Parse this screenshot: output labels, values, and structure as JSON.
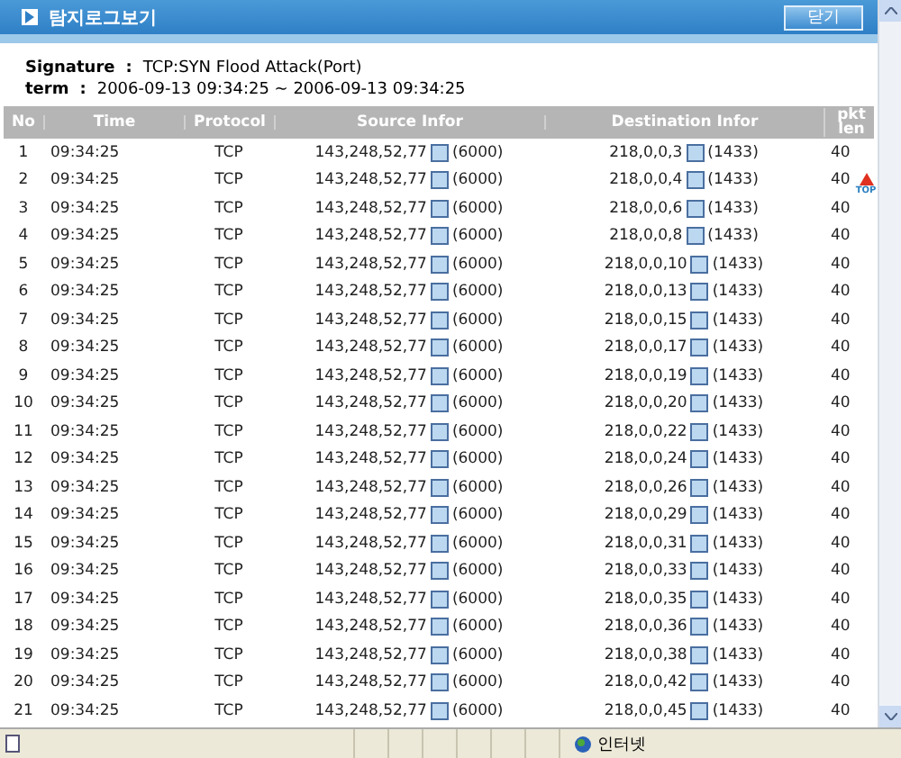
{
  "window": {
    "title": "탐지로그보기",
    "close_button": "닫기"
  },
  "info": [
    {
      "label": "Signature",
      "separator": ":",
      "value": "TCP:SYN Flood Attack(Port)"
    },
    {
      "label": "term",
      "separator": ":",
      "value": "2006-09-13 09:34:25 ~ 2006-09-13 09:34:25"
    }
  ],
  "table": {
    "columns": [
      "No",
      "Time",
      "Protocol",
      "Source Infor",
      "Destination Infor",
      "pkt len"
    ],
    "rows": [
      {
        "no": "1",
        "time": "09:34:25",
        "protocol": "TCP",
        "source": "143,248,52,77",
        "source_port": "(6000)",
        "destination": "218,0,0,3",
        "destination_port": "(1433)",
        "pkt_len": "40"
      },
      {
        "no": "2",
        "time": "09:34:25",
        "protocol": "TCP",
        "source": "143,248,52,77",
        "source_port": "(6000)",
        "destination": "218,0,0,4",
        "destination_port": "(1433)",
        "pkt_len": "40"
      },
      {
        "no": "3",
        "time": "09:34:25",
        "protocol": "TCP",
        "source": "143,248,52,77",
        "source_port": "(6000)",
        "destination": "218,0,0,6",
        "destination_port": "(1433)",
        "pkt_len": "40"
      },
      {
        "no": "4",
        "time": "09:34:25",
        "protocol": "TCP",
        "source": "143,248,52,77",
        "source_port": "(6000)",
        "destination": "218,0,0,8",
        "destination_port": "(1433)",
        "pkt_len": "40"
      },
      {
        "no": "5",
        "time": "09:34:25",
        "protocol": "TCP",
        "source": "143,248,52,77",
        "source_port": "(6000)",
        "destination": "218,0,0,10",
        "destination_port": "(1433)",
        "pkt_len": "40"
      },
      {
        "no": "6",
        "time": "09:34:25",
        "protocol": "TCP",
        "source": "143,248,52,77",
        "source_port": "(6000)",
        "destination": "218,0,0,13",
        "destination_port": "(1433)",
        "pkt_len": "40"
      },
      {
        "no": "7",
        "time": "09:34:25",
        "protocol": "TCP",
        "source": "143,248,52,77",
        "source_port": "(6000)",
        "destination": "218,0,0,15",
        "destination_port": "(1433)",
        "pkt_len": "40"
      },
      {
        "no": "8",
        "time": "09:34:25",
        "protocol": "TCP",
        "source": "143,248,52,77",
        "source_port": "(6000)",
        "destination": "218,0,0,17",
        "destination_port": "(1433)",
        "pkt_len": "40"
      },
      {
        "no": "9",
        "time": "09:34:25",
        "protocol": "TCP",
        "source": "143,248,52,77",
        "source_port": "(6000)",
        "destination": "218,0,0,19",
        "destination_port": "(1433)",
        "pkt_len": "40"
      },
      {
        "no": "10",
        "time": "09:34:25",
        "protocol": "TCP",
        "source": "143,248,52,77",
        "source_port": "(6000)",
        "destination": "218,0,0,20",
        "destination_port": "(1433)",
        "pkt_len": "40"
      },
      {
        "no": "11",
        "time": "09:34:25",
        "protocol": "TCP",
        "source": "143,248,52,77",
        "source_port": "(6000)",
        "destination": "218,0,0,22",
        "destination_port": "(1433)",
        "pkt_len": "40"
      },
      {
        "no": "12",
        "time": "09:34:25",
        "protocol": "TCP",
        "source": "143,248,52,77",
        "source_port": "(6000)",
        "destination": "218,0,0,24",
        "destination_port": "(1433)",
        "pkt_len": "40"
      },
      {
        "no": "13",
        "time": "09:34:25",
        "protocol": "TCP",
        "source": "143,248,52,77",
        "source_port": "(6000)",
        "destination": "218,0,0,26",
        "destination_port": "(1433)",
        "pkt_len": "40"
      },
      {
        "no": "14",
        "time": "09:34:25",
        "protocol": "TCP",
        "source": "143,248,52,77",
        "source_port": "(6000)",
        "destination": "218,0,0,29",
        "destination_port": "(1433)",
        "pkt_len": "40"
      },
      {
        "no": "15",
        "time": "09:34:25",
        "protocol": "TCP",
        "source": "143,248,52,77",
        "source_port": "(6000)",
        "destination": "218,0,0,31",
        "destination_port": "(1433)",
        "pkt_len": "40"
      },
      {
        "no": "16",
        "time": "09:34:25",
        "protocol": "TCP",
        "source": "143,248,52,77",
        "source_port": "(6000)",
        "destination": "218,0,0,33",
        "destination_port": "(1433)",
        "pkt_len": "40"
      },
      {
        "no": "17",
        "time": "09:34:25",
        "protocol": "TCP",
        "source": "143,248,52,77",
        "source_port": "(6000)",
        "destination": "218,0,0,35",
        "destination_port": "(1433)",
        "pkt_len": "40"
      },
      {
        "no": "18",
        "time": "09:34:25",
        "protocol": "TCP",
        "source": "143,248,52,77",
        "source_port": "(6000)",
        "destination": "218,0,0,36",
        "destination_port": "(1433)",
        "pkt_len": "40"
      },
      {
        "no": "19",
        "time": "09:34:25",
        "protocol": "TCP",
        "source": "143,248,52,77",
        "source_port": "(6000)",
        "destination": "218,0,0,38",
        "destination_port": "(1433)",
        "pkt_len": "40"
      },
      {
        "no": "20",
        "time": "09:34:25",
        "protocol": "TCP",
        "source": "143,248,52,77",
        "source_port": "(6000)",
        "destination": "218,0,0,42",
        "destination_port": "(1433)",
        "pkt_len": "40"
      },
      {
        "no": "21",
        "time": "09:34:25",
        "protocol": "TCP",
        "source": "143,248,52,77",
        "source_port": "(6000)",
        "destination": "218,0,0,45",
        "destination_port": "(1433)",
        "pkt_len": "40"
      }
    ]
  },
  "top_button": "TOP",
  "status_bar": {
    "zone": "인터넷"
  }
}
